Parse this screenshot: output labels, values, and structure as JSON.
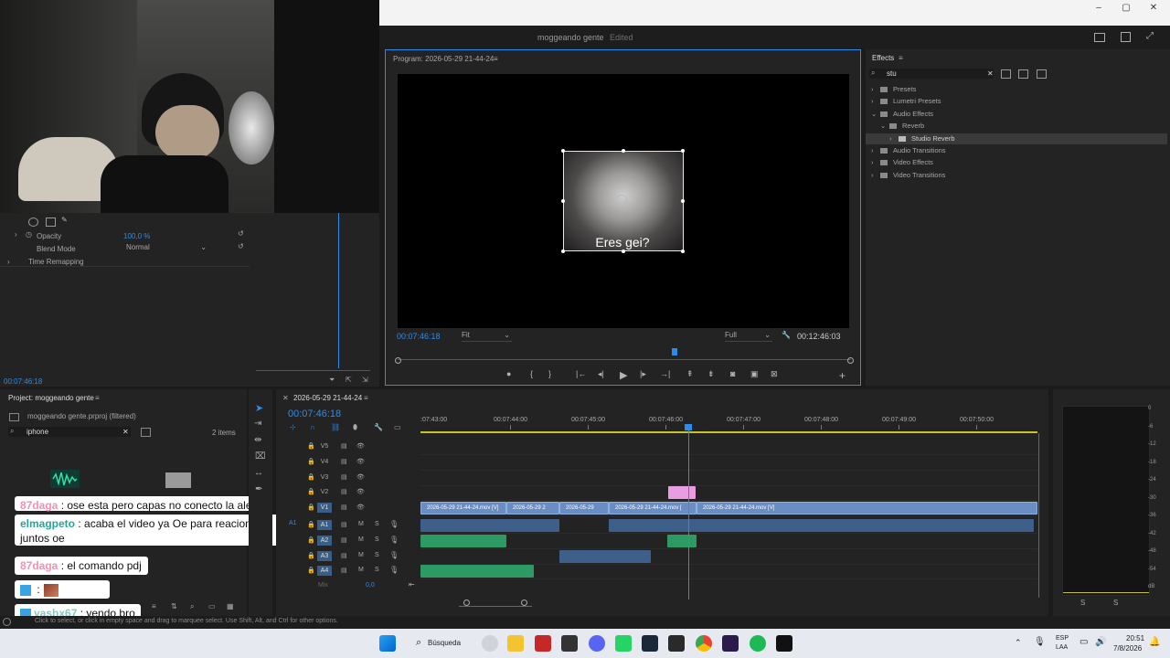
{
  "window": {
    "minimize": "–",
    "maximize": "▢",
    "close": "✕"
  },
  "project_header": {
    "title": "moggeando gente",
    "state": "Edited"
  },
  "program": {
    "tab_label": "Program: 2026-05-29 21-44-24",
    "menu_icon": "≡",
    "timecode": "00:07:46:18",
    "fit": "Fit",
    "quality": "Full",
    "duration": "00:12:46:03",
    "caption": "Eres gei?",
    "playhead_fraction": 0.61
  },
  "effects": {
    "tab_label": "Effects",
    "menu_icon": "≡",
    "search_value": "stu",
    "tree": [
      {
        "label": "Presets",
        "level": 0,
        "open": false
      },
      {
        "label": "Lumetri Presets",
        "level": 0,
        "open": false
      },
      {
        "label": "Audio Effects",
        "level": 0,
        "open": true
      },
      {
        "label": "Reverb",
        "level": 1,
        "open": true
      },
      {
        "label": "Studio Reverb",
        "level": 2,
        "open": false,
        "selected": true
      },
      {
        "label": "Audio Transitions",
        "level": 0,
        "open": false
      },
      {
        "label": "Video Effects",
        "level": 0,
        "open": false
      },
      {
        "label": "Video Transitions",
        "level": 0,
        "open": false
      }
    ]
  },
  "effect_controls": {
    "opacity_label": "Opacity",
    "opacity_value": "100,0 %",
    "blend_label": "Blend Mode",
    "blend_value": "Normal",
    "time_remap": "Time Remapping",
    "timecode": "00:07:46:18"
  },
  "project_panel": {
    "title": "Project: moggeando gente",
    "menu_icon": "≡",
    "file": "moggeando gente.prproj (filtered)",
    "search": "iphone",
    "count": "2 items"
  },
  "timeline": {
    "tab_label": "2026-05-29 21-44-24",
    "menu_icon": "≡",
    "timecode": "00:07:46:18",
    "ruler": [
      "00:07:43:00",
      "00:07:44:00",
      "00:07:45:00",
      "00:07:46:00",
      "00:07:47:00",
      "00:07:48:00",
      "00:07:49:00",
      "00:07:50:00"
    ],
    "ruler_start": ":07:43:00",
    "video_tracks": [
      "V5",
      "V4",
      "V3",
      "V2",
      "V1"
    ],
    "audio_tracks": [
      "A1",
      "A2",
      "A3",
      "A4"
    ],
    "mix_label": "Mix",
    "mix_value": "0,0",
    "track_buttons": {
      "m": "M",
      "s": "S"
    },
    "clips_v1": [
      "2026-05-29 21-44-24.mov [V]",
      "2026-05-29 2",
      "2026-05-29",
      "2026-05-29 21-44-24.mov [",
      "2026-05-29 21-44-24.mov [V]"
    ]
  },
  "meters": {
    "scale": [
      "0",
      "-6",
      "-12",
      "-18",
      "-24",
      "-30",
      "-36",
      "-42",
      "-48",
      "-54",
      "dB"
    ],
    "solo": [
      "S",
      "S"
    ]
  },
  "chat": [
    {
      "user": "87daga",
      "text": " : ose esta pero capas no conecto la alexa",
      "color": "#f48fb1"
    },
    {
      "user": "elmagpeto",
      "text": " : acaba el video ya Oe para reacionarlo juntos oe",
      "color": "#26a69a"
    },
    {
      "user": "87daga",
      "text": " : el comando pdj",
      "color": "#f48fb1"
    },
    {
      "user": "",
      "text": " :",
      "color": "#111"
    },
    {
      "user": "yashx67",
      "text": " : yendo bro",
      "color": "#80cbc4"
    }
  ],
  "status": {
    "text": "Click to select, or click in empty space and drag to marquee select. Use Shift, Alt, and Ctrl for other options."
  },
  "taskbar": {
    "search": "Búsqueda",
    "lang1": "ESP",
    "lang2": "LAA",
    "time": "20:51",
    "date": "7/8/2026"
  },
  "colors": {
    "accent": "#2d8ceb",
    "clip_video": "#6a8ec4",
    "clip_green": "#2c9a62",
    "clip_pink": "#e79de0"
  }
}
